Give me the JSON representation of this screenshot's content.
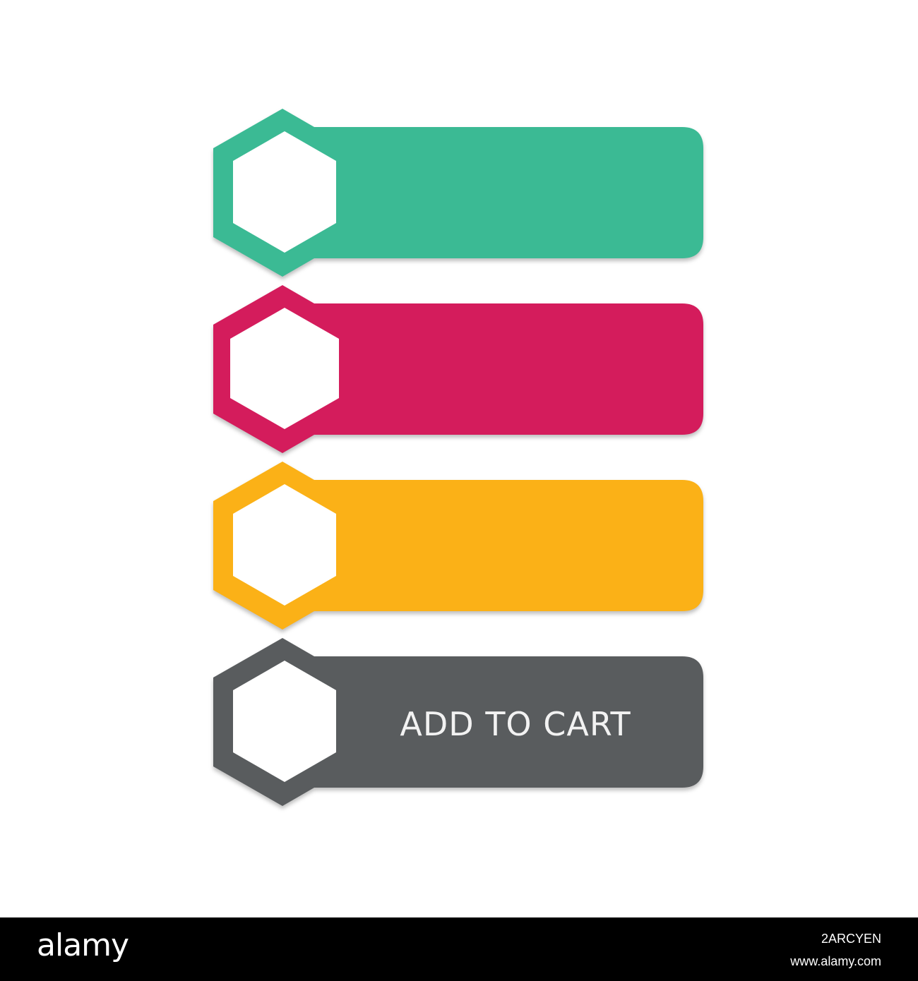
{
  "buttons": [
    {
      "name": "teal-label-button",
      "color": "#3bba94",
      "label": ""
    },
    {
      "name": "pink-label-button",
      "color": "#d41c5c",
      "label": ""
    },
    {
      "name": "yellow-label-button",
      "color": "#fbb117",
      "label": ""
    },
    {
      "name": "add-to-cart-button",
      "color": "#595c5e",
      "label": "ADD TO CART"
    }
  ],
  "footer": {
    "logo": "alamy",
    "image_id": "2ARCYEN",
    "url": "www.alamy.com"
  }
}
